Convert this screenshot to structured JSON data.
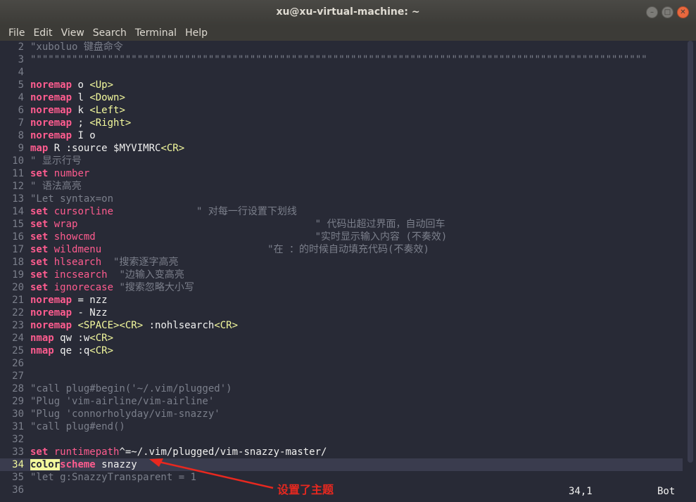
{
  "window": {
    "title": "xu@xu-virtual-machine: ~"
  },
  "menubar": {
    "items": [
      "File",
      "Edit",
      "View",
      "Search",
      "Terminal",
      "Help"
    ]
  },
  "editor": {
    "lines": [
      {
        "n": "2",
        "segs": [
          [
            "cmt",
            "\"xuboluo 键盘命令"
          ]
        ]
      },
      {
        "n": "3",
        "segs": [
          [
            "cmt",
            "\"\"\"\"\"\"\"\"\"\"\"\"\"\"\"\"\"\"\"\"\"\"\"\"\"\"\"\"\"\"\"\"\"\"\"\"\"\"\"\"\"\"\"\"\"\"\"\"\"\"\"\"\"\"\"\"\"\"\"\"\"\"\"\"\"\"\"\"\"\"\"\"\"\"\"\"\"\"\"\"\"\"\"\"\"\"\"\"\"\"\"\"\"\"\"\"\"\"\"\"\"\"\"\""
          ]
        ]
      },
      {
        "n": "4",
        "segs": []
      },
      {
        "n": "5",
        "segs": [
          [
            "kw",
            "noremap"
          ],
          [
            "t",
            " o "
          ],
          [
            "key",
            "<Up>"
          ]
        ]
      },
      {
        "n": "4",
        "segs": [
          [
            "kw",
            "noremap"
          ],
          [
            "t",
            " l "
          ],
          [
            "key",
            "<Down>"
          ]
        ]
      },
      {
        "n": "6",
        "segs": [
          [
            "kw",
            "noremap"
          ],
          [
            "t",
            " k "
          ],
          [
            "key",
            "<Left>"
          ]
        ]
      },
      {
        "n": "7",
        "segs": [
          [
            "kw",
            "noremap"
          ],
          [
            "t",
            " ; "
          ],
          [
            "key",
            "<Right>"
          ]
        ]
      },
      {
        "n": "8",
        "segs": [
          [
            "kw",
            "noremap"
          ],
          [
            "t",
            " I o"
          ]
        ]
      },
      {
        "n": "9",
        "segs": [
          [
            "kw",
            "map"
          ],
          [
            "t",
            " R :source $MYVIMRC"
          ],
          [
            "key",
            "<CR>"
          ]
        ]
      },
      {
        "n": "10",
        "segs": [
          [
            "cmt",
            "\" 显示行号"
          ]
        ]
      },
      {
        "n": "11",
        "segs": [
          [
            "kw",
            "set"
          ],
          [
            "t",
            " "
          ],
          [
            "opt",
            "number"
          ]
        ]
      },
      {
        "n": "12",
        "segs": [
          [
            "cmt",
            "\" 语法高亮"
          ]
        ]
      },
      {
        "n": "13",
        "segs": [
          [
            "cmt",
            "\"Let syntax=on"
          ]
        ]
      },
      {
        "n": "14",
        "segs": [
          [
            "kw",
            "set"
          ],
          [
            "t",
            " "
          ],
          [
            "opt",
            "cursorline"
          ],
          [
            "cmt",
            "              \" 对每一行设置下划线"
          ]
        ]
      },
      {
        "n": "15",
        "segs": [
          [
            "kw",
            "set"
          ],
          [
            "t",
            " "
          ],
          [
            "opt",
            "wrap"
          ],
          [
            "cmt",
            "                                        \" 代码出超过界面，自动回车"
          ]
        ]
      },
      {
        "n": "16",
        "segs": [
          [
            "kw",
            "set"
          ],
          [
            "t",
            " "
          ],
          [
            "opt",
            "showcmd"
          ],
          [
            "cmt",
            "                                     \"实时显示输入内容 (不奏效)"
          ]
        ]
      },
      {
        "n": "17",
        "segs": [
          [
            "kw",
            "set"
          ],
          [
            "t",
            " "
          ],
          [
            "opt",
            "wildmenu"
          ],
          [
            "cmt",
            "                            \"在 ：的时候自动填充代码(不奏效)"
          ]
        ]
      },
      {
        "n": "18",
        "segs": [
          [
            "kw",
            "set"
          ],
          [
            "t",
            " "
          ],
          [
            "opt",
            "hlsearch"
          ],
          [
            "cmt",
            "  \"搜索逐字高亮"
          ]
        ]
      },
      {
        "n": "19",
        "segs": [
          [
            "kw",
            "set"
          ],
          [
            "t",
            " "
          ],
          [
            "opt",
            "incsearch"
          ],
          [
            "cmt",
            "  \"边输入变高亮"
          ]
        ]
      },
      {
        "n": "20",
        "segs": [
          [
            "kw",
            "set"
          ],
          [
            "t",
            " "
          ],
          [
            "opt",
            "ignorecase"
          ],
          [
            "cmt",
            " \"搜索忽略大小写"
          ]
        ]
      },
      {
        "n": "21",
        "segs": [
          [
            "kw",
            "noremap"
          ],
          [
            "t",
            " = nzz"
          ]
        ]
      },
      {
        "n": "22",
        "segs": [
          [
            "kw",
            "noremap"
          ],
          [
            "t",
            " - Nzz"
          ]
        ]
      },
      {
        "n": "23",
        "segs": [
          [
            "kw",
            "noremap"
          ],
          [
            "t",
            " "
          ],
          [
            "key",
            "<SPACE><CR>"
          ],
          [
            "t",
            " :nohlsearch"
          ],
          [
            "key",
            "<CR>"
          ]
        ]
      },
      {
        "n": "24",
        "segs": [
          [
            "kw",
            "nmap"
          ],
          [
            "t",
            " qw :w"
          ],
          [
            "key",
            "<CR>"
          ]
        ]
      },
      {
        "n": "25",
        "segs": [
          [
            "kw",
            "nmap"
          ],
          [
            "t",
            " qe :q"
          ],
          [
            "key",
            "<CR>"
          ]
        ]
      },
      {
        "n": "26",
        "segs": []
      },
      {
        "n": "27",
        "segs": []
      },
      {
        "n": "28",
        "segs": [
          [
            "cmt",
            "\"call plug#begin('~/.vim/plugged')"
          ]
        ]
      },
      {
        "n": "29",
        "segs": [
          [
            "cmt",
            "\"Plug 'vim-airline/vim-airline'"
          ]
        ]
      },
      {
        "n": "30",
        "segs": [
          [
            "cmt",
            "\"Plug 'connorholyday/vim-snazzy'"
          ]
        ]
      },
      {
        "n": "31",
        "segs": [
          [
            "cmt",
            "\"call plug#end()"
          ]
        ]
      },
      {
        "n": "32",
        "segs": []
      },
      {
        "n": "33",
        "segs": [
          [
            "kw",
            "set"
          ],
          [
            "t",
            " "
          ],
          [
            "opt",
            "runtimepath"
          ],
          [
            "t",
            "^=~/.vim/plugged/vim-snazzy-master/"
          ]
        ]
      },
      {
        "n": "34",
        "cursor": true,
        "segs": [
          [
            "hl",
            "color"
          ],
          [
            "kw",
            "scheme"
          ],
          [
            "t",
            " snazzy"
          ]
        ]
      },
      {
        "n": "35",
        "segs": [
          [
            "cmt",
            "\"let g:SnazzyTransparent = 1"
          ]
        ]
      },
      {
        "n": "36",
        "segs": []
      }
    ],
    "status": {
      "position": "34,1",
      "scroll": "Bot"
    }
  },
  "annotation": {
    "text": "设置了主题",
    "color": "#e8281f"
  }
}
